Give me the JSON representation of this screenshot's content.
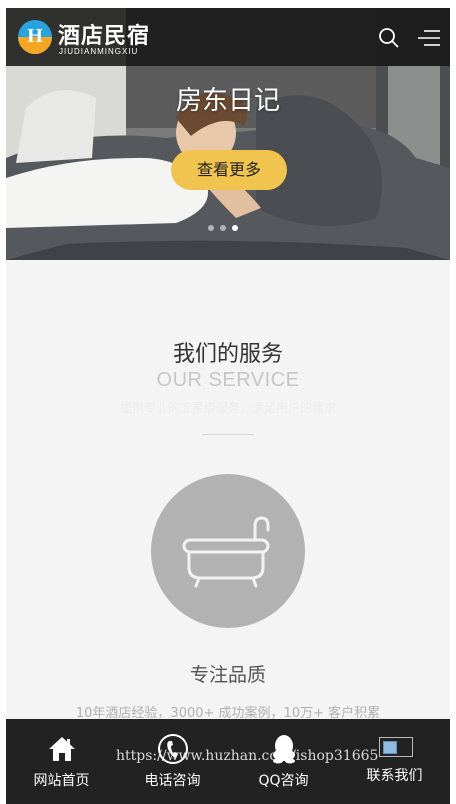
{
  "header": {
    "logo_mark": "H",
    "logo_cn": "酒店民宿",
    "logo_en": "JIUDIANMINGXIU",
    "search_icon": "search-icon",
    "menu_icon": "hamburger-menu-icon"
  },
  "banner": {
    "title": "房东日记",
    "button_label": "查看更多",
    "slide_count": 3,
    "active_slide": 2
  },
  "service": {
    "title": "我们的服务",
    "subtitle_en": "OUR SERVICE",
    "description": "提供专业的五星级服务，满足用户的需求",
    "feature_icon": "bathtub-icon",
    "feature_title": "专注品质",
    "feature_desc": "10年酒店经验，3000+ 成功案例，10万+ 客户积累"
  },
  "bottom_nav": {
    "items": [
      {
        "label": "网站首页",
        "icon": "home-icon"
      },
      {
        "label": "电话咨询",
        "icon": "phone-icon"
      },
      {
        "label": "QQ咨询",
        "icon": "qq-penguin-icon"
      },
      {
        "label": "联系我们",
        "icon": "broken-image-icon"
      }
    ],
    "watermark": "https://www.huzhan.com/ishop31665"
  },
  "colors": {
    "accent_yellow": "#f0c44e",
    "header_bg": "#181818",
    "bottom_bar_bg": "#222222",
    "page_bg": "#f4f4f4",
    "circle_gray": "#b2b2b2"
  }
}
